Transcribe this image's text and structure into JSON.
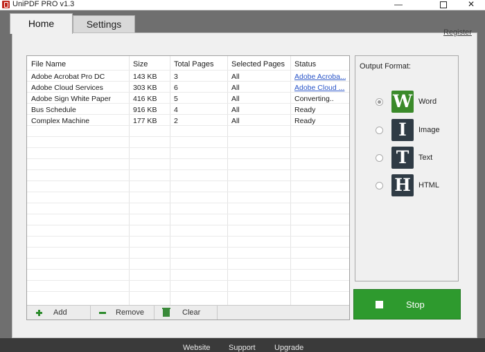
{
  "window": {
    "title": "UniPDF PRO v1.3",
    "controls": {
      "minimize": "—",
      "close": "✕"
    }
  },
  "tabs": [
    {
      "label": "Home"
    },
    {
      "label": "Settings"
    }
  ],
  "register_link": "Register",
  "table": {
    "columns": [
      "File Name",
      "Size",
      "Total Pages",
      "Selected Pages",
      "Status"
    ],
    "rows": [
      {
        "file": "Adobe Acrobat Pro DC",
        "size": "143 KB",
        "pages": "3",
        "selected": "All",
        "status": "Adobe Acroba..."
      },
      {
        "file": "Adobe Cloud Services",
        "size": "303 KB",
        "pages": "6",
        "selected": "All",
        "status": "Adobe Cloud ..."
      },
      {
        "file": "Adobe Sign White Paper",
        "size": "416 KB",
        "pages": "5",
        "selected": "All",
        "status": "Converting.."
      },
      {
        "file": "Bus Schedule",
        "size": "916 KB",
        "pages": "4",
        "selected": "All",
        "status": "Ready"
      },
      {
        "file": "Complex Machine",
        "size": "177 KB",
        "pages": "2",
        "selected": "All",
        "status": "Ready"
      }
    ]
  },
  "toolbar": {
    "add": "Add",
    "remove": "Remove",
    "clear": "Clear"
  },
  "output": {
    "label": "Output Format:",
    "selected": "Word",
    "options": [
      {
        "letter": "W",
        "label": "Word",
        "color": "#3a8a2a"
      },
      {
        "letter": "I",
        "label": "Image",
        "color": "#2f3b45"
      },
      {
        "letter": "T",
        "label": "Text",
        "color": "#2f3b45"
      },
      {
        "letter": "H",
        "label": "HTML",
        "color": "#2f3b45"
      }
    ]
  },
  "stop_button": {
    "label": "Stop",
    "color": "#2e9a2e"
  },
  "footer": {
    "website": "Website",
    "support": "Support",
    "upgrade": "Upgrade"
  }
}
